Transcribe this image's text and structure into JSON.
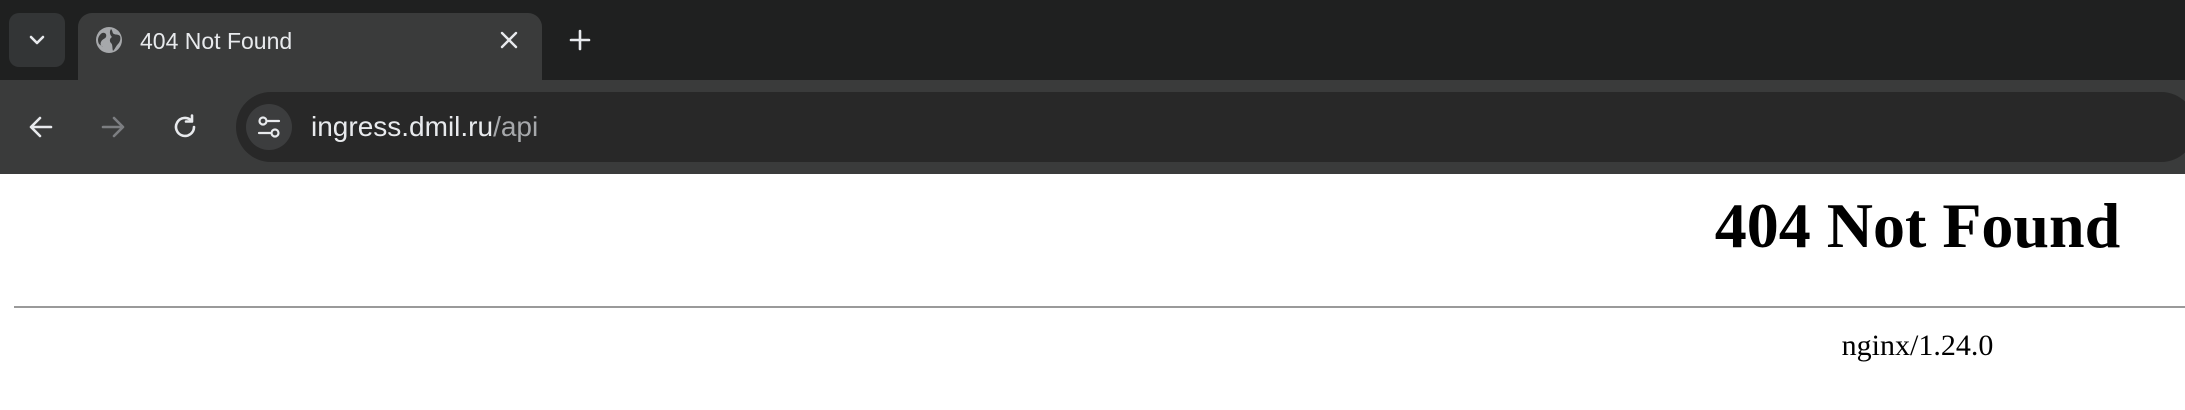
{
  "browser": {
    "tab": {
      "title": "404 Not Found",
      "favicon": "globe-icon"
    },
    "tab_search_icon": "chevron-down-icon",
    "new_tab_icon": "plus-icon",
    "close_tab_icon": "close-icon",
    "nav": {
      "back_icon": "arrow-left-icon",
      "forward_icon": "arrow-right-icon",
      "reload_icon": "reload-icon"
    },
    "omnibox": {
      "site_info_icon": "tune-icon",
      "url_host": "ingress.dmil.ru",
      "url_path": "/api"
    },
    "colors": {
      "tabstrip_bg": "#1f2020",
      "active_tab_bg": "#3a3b3b",
      "omnibox_bg": "#282828",
      "text_primary": "#e8eaed",
      "text_secondary": "#a6a8ab"
    }
  },
  "page": {
    "heading": "404 Not Found",
    "server_signature": "nginx/1.24.0"
  }
}
